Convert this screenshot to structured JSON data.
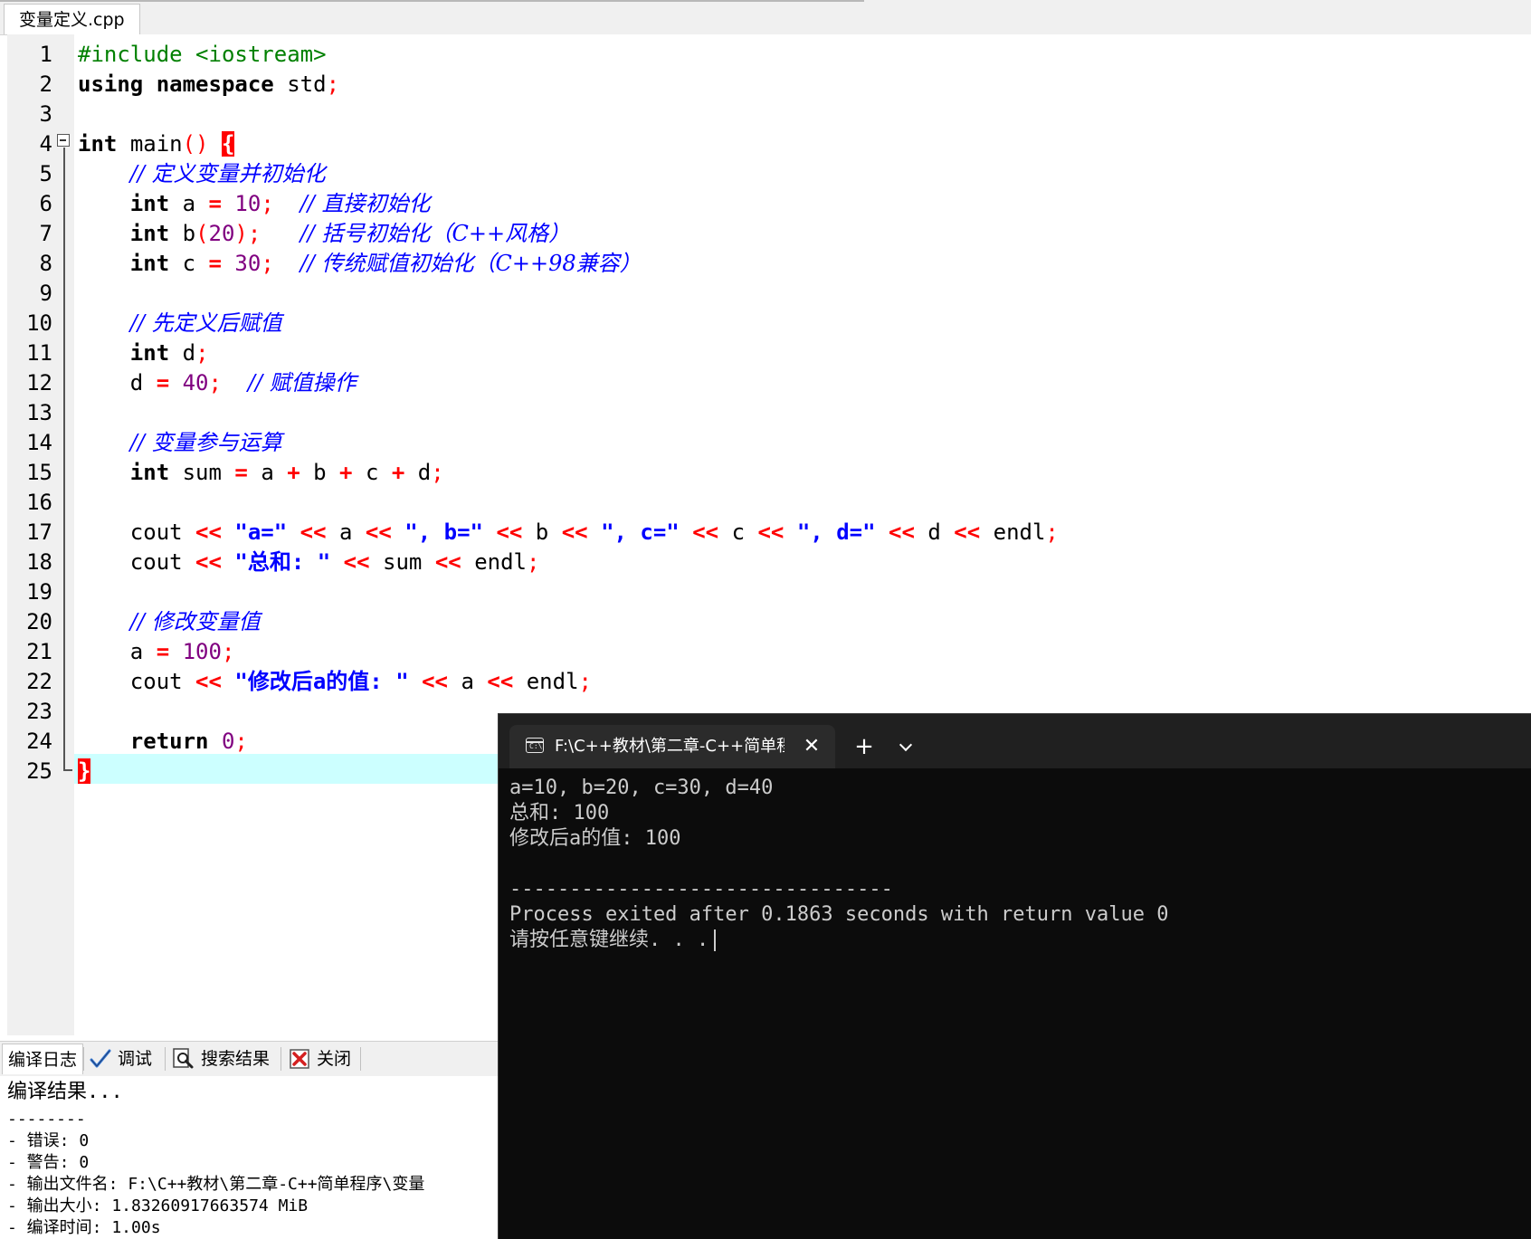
{
  "editor": {
    "tab_label": "变量定义.cpp",
    "line_numbers": [
      "1",
      "2",
      "3",
      "4",
      "5",
      "6",
      "7",
      "8",
      "9",
      "10",
      "11",
      "12",
      "13",
      "14",
      "15",
      "16",
      "17",
      "18",
      "19",
      "20",
      "21",
      "22",
      "23",
      "24",
      "25"
    ]
  },
  "code": {
    "l1": {
      "pre": "#include <iostream>"
    },
    "l2": {
      "kw1": "using",
      "kw2": "namespace",
      "id": "std",
      "semi": ";"
    },
    "l4": {
      "kw": "int",
      "id": "main",
      "parens": "()",
      "brace": "{"
    },
    "l5": {
      "cmt": "// 定义变量并初始化"
    },
    "l6": {
      "kw": "int",
      "id": "a",
      "eq": "=",
      "num": "10",
      "semi": ";",
      "cmt": "// 直接初始化"
    },
    "l7": {
      "kw": "int",
      "id": "b",
      "lp": "(",
      "num": "20",
      "rp": ")",
      "semi": ";",
      "cmt": "// 括号初始化（C++风格）"
    },
    "l8": {
      "kw": "int",
      "id": "c",
      "eq": "=",
      "num": "30",
      "semi": ";",
      "cmt": "// 传统赋值初始化（C++98兼容）"
    },
    "l10": {
      "cmt": "// 先定义后赋值"
    },
    "l11": {
      "kw": "int",
      "id": "d",
      "semi": ";"
    },
    "l12": {
      "id": "d",
      "eq": "=",
      "num": "40",
      "semi": ";",
      "cmt": "// 赋值操作"
    },
    "l14": {
      "cmt": "// 变量参与运算"
    },
    "l15": {
      "kw": "int",
      "id": "sum",
      "eq": "=",
      "a": "a",
      "plus": "+",
      "b": "b",
      "c": "c",
      "d": "d",
      "semi": ";"
    },
    "l17": {
      "cout": "cout",
      "shl": "<<",
      "s1": "\"a=\"",
      "a": "a",
      "s2": "\", b=\"",
      "b": "b",
      "s3": "\", c=\"",
      "c": "c",
      "s4": "\", d=\"",
      "d": "d",
      "endl": "endl",
      "semi": ";"
    },
    "l18": {
      "cout": "cout",
      "shl": "<<",
      "s1": "\"总和: \"",
      "sum": "sum",
      "endl": "endl",
      "semi": ";"
    },
    "l20": {
      "cmt": "// 修改变量值"
    },
    "l21": {
      "id": "a",
      "eq": "=",
      "num": "100",
      "semi": ";"
    },
    "l22": {
      "cout": "cout",
      "shl": "<<",
      "s1": "\"修改后a的值: \"",
      "a": "a",
      "endl": "endl",
      "semi": ";"
    },
    "l24": {
      "kw": "return",
      "num": "0",
      "semi": ";"
    },
    "l25": {
      "brace": "}"
    }
  },
  "bottom_panel": {
    "tabs": {
      "compile_log": "编译日志",
      "debug": "调试",
      "search_results": "搜索结果",
      "close": "关闭"
    },
    "log_lines": [
      "编译结果...",
      "--------",
      "- 错误: 0",
      "- 警告: 0",
      "- 输出文件名: F:\\C++教材\\第二章-C++简单程序\\变量",
      "- 输出大小: 1.83260917663574 MiB",
      "- 编译时间: 1.00s"
    ]
  },
  "console": {
    "tab_title": "F:\\C++教材\\第二章-C++简单程",
    "close_glyph": "✕",
    "new_tab_glyph": "+",
    "icon_text": "C:\\",
    "output_lines": [
      "a=10, b=20, c=30, d=40",
      "总和: 100",
      "修改后a的值: 100",
      "",
      "--------------------------------",
      "Process exited after 0.1863 seconds with return value 0",
      "请按任意键继续. . ."
    ]
  }
}
